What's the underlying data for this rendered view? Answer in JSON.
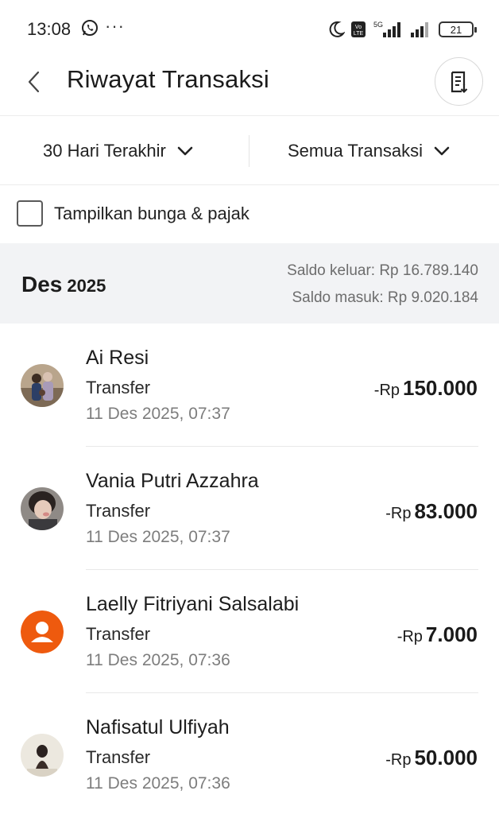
{
  "status_bar": {
    "time": "13:08",
    "dots": "···",
    "battery": "21",
    "network": "5G"
  },
  "header": {
    "title": "Riwayat Transaksi"
  },
  "filters": {
    "period": "30 Hari Terakhir",
    "type": "Semua Transaksi"
  },
  "toggle": {
    "label": "Tampilkan bunga & pajak",
    "checked": false
  },
  "month": {
    "month": "Des",
    "year": "2025",
    "saldo_keluar": "Saldo keluar: Rp 16.789.140",
    "saldo_masuk": "Saldo masuk: Rp 9.020.184"
  },
  "transactions": [
    {
      "name": "Ai Resi",
      "type": "Transfer",
      "date": "11 Des 2025, 07:37",
      "currency": "-Rp",
      "amount": "150.000",
      "avatar": "photo-avatar"
    },
    {
      "name": "Vania Putri Azzahra",
      "type": "Transfer",
      "date": "11 Des 2025, 07:37",
      "currency": "-Rp",
      "amount": "83.000",
      "avatar": "photo-avatar"
    },
    {
      "name": "Laelly Fitriyani Salsalabi",
      "type": "Transfer",
      "date": "11 Des 2025, 07:36",
      "currency": "-Rp",
      "amount": "7.000",
      "avatar": "default-user-icon"
    },
    {
      "name": "Nafisatul Ulfiyah",
      "type": "Transfer",
      "date": "11 Des 2025, 07:36",
      "currency": "-Rp",
      "amount": "50.000",
      "avatar": "photo-avatar"
    }
  ],
  "colors": {
    "accent_orange": "#EE5A0E",
    "month_bar_bg": "#F2F3F5"
  }
}
